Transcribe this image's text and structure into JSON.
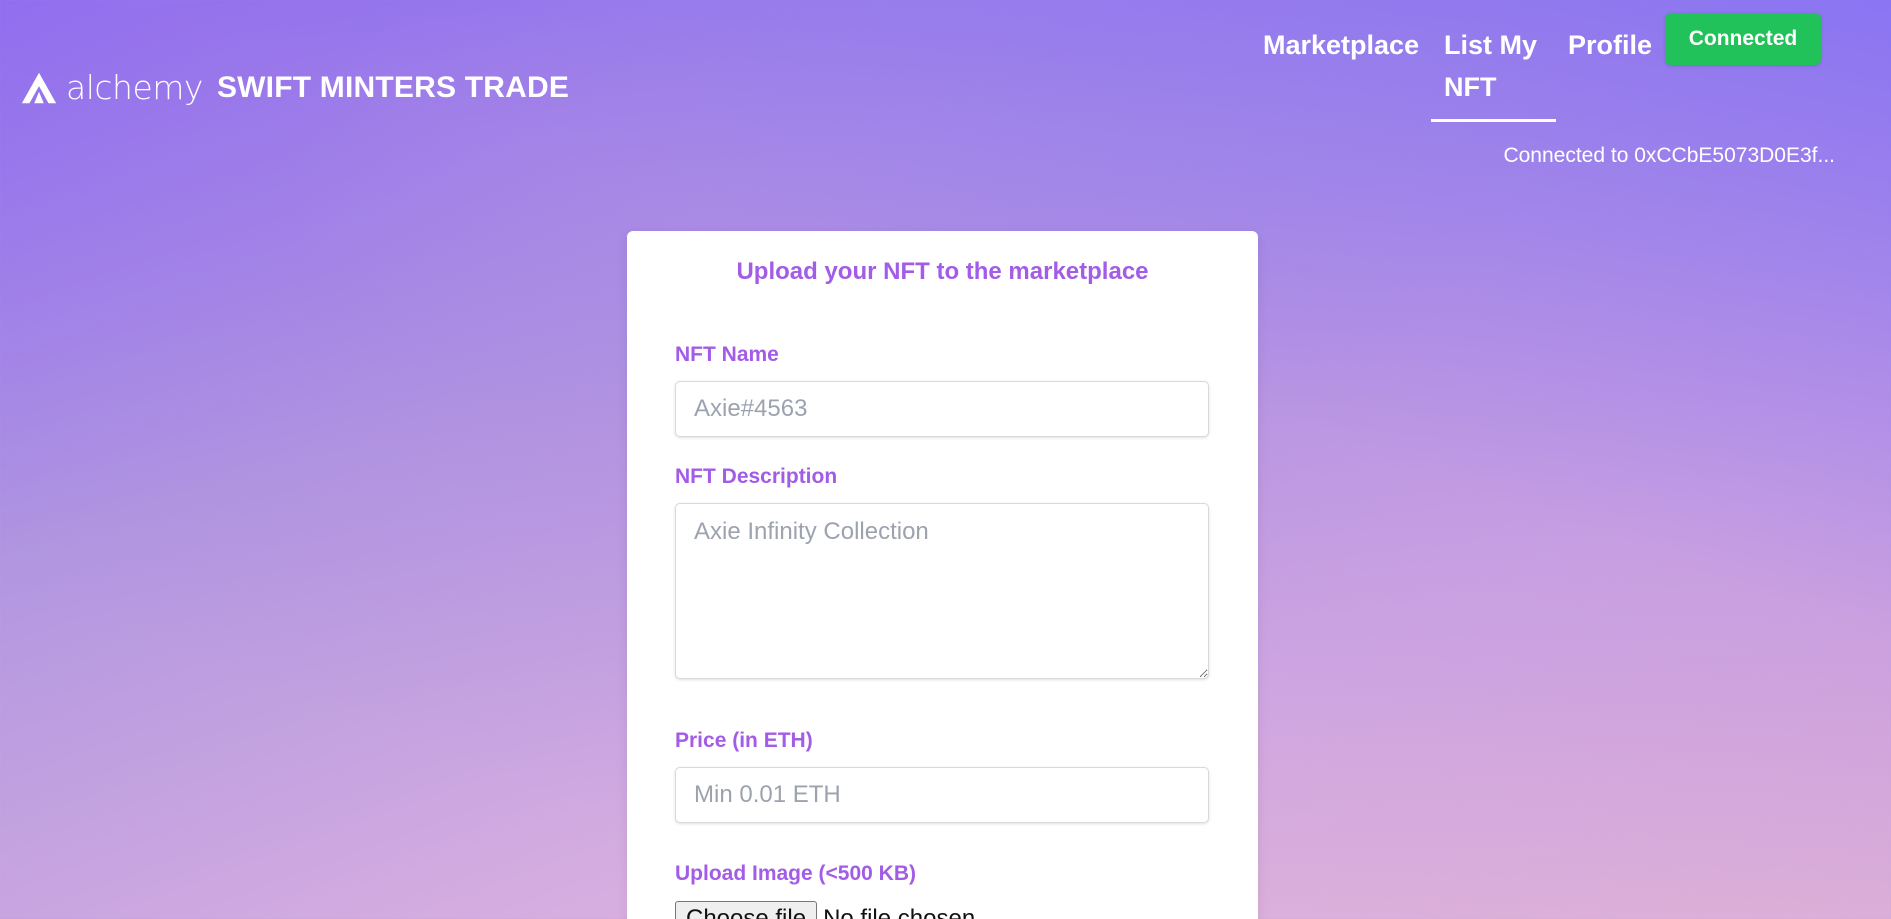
{
  "header": {
    "logo_word": "alchemy",
    "brand_title": "SWIFT MINTERS TRADE",
    "nav": [
      {
        "label": "Marketplace"
      },
      {
        "label": "List My NFT"
      },
      {
        "label": "Profile"
      }
    ],
    "connect_button": "Connected",
    "connected_text": "Connected to 0xCCbE5073D0E3f..."
  },
  "form": {
    "title": "Upload your NFT to the marketplace",
    "name_label": "NFT Name",
    "name_placeholder": "Axie#4563",
    "description_label": "NFT Description",
    "description_placeholder": "Axie Infinity Collection",
    "price_label": "Price (in ETH)",
    "price_placeholder": "Min 0.01 ETH",
    "image_label": "Upload Image (<500 KB)",
    "file_button": "Choose file",
    "file_status": "No file chosen"
  },
  "colors": {
    "accent": "#a35ce6",
    "connect_green": "#22c25a"
  },
  "icons": {
    "logo": "alchemy-logo-icon"
  }
}
